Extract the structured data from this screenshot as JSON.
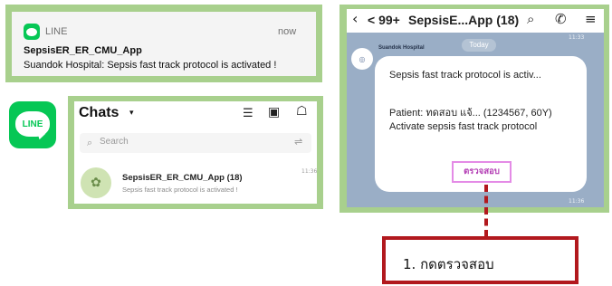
{
  "notification": {
    "app_name": "LINE",
    "time": "now",
    "title": "SepsisER_ER_CMU_App",
    "message": "Suandok Hospital: Sepsis fast track protocol is activated !"
  },
  "app_icon": {
    "label": "LINE"
  },
  "chats": {
    "title": "Chats",
    "search_placeholder": "Search",
    "items": [
      {
        "name": "SepsisER_ER_CMU_App",
        "count": "(18)",
        "preview": "Sepsis fast track protocol is activated !",
        "time": "11:36"
      }
    ]
  },
  "chat_room": {
    "back_label": "< 99+",
    "title": "SepsisE...App (18)",
    "date_chip": "Today",
    "timestamp_top": "11:33",
    "timestamp_bottom": "11:36",
    "sender_name": "Suandok Hospital",
    "message_title": "Sepsis fast track protocol is activ...",
    "message_body": "Patient: ทดสอบ แจ้... (1234567, 60Y) Activate sepsis fast track protocol",
    "action_button": "ตรวจสอบ"
  },
  "callout": {
    "text": "1. กดตรวจสอบ"
  },
  "colors": {
    "frame_green": "#a8d08d",
    "line_green": "#06c755",
    "chat_bg": "#9aaec6",
    "highlight_magenta": "#e48be6",
    "callout_red": "#b2191e"
  }
}
